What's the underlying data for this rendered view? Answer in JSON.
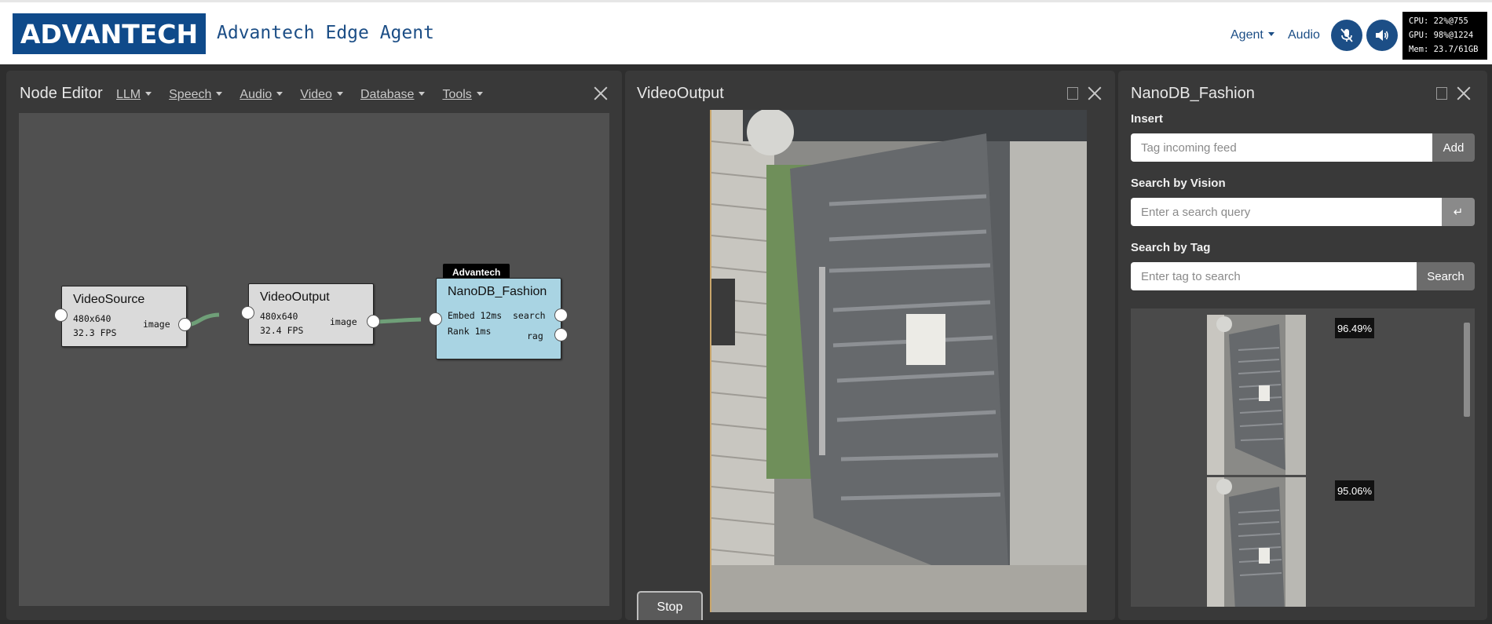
{
  "header": {
    "logo_text": "ADVANTECH",
    "app_title": "Advantech Edge Agent",
    "nav": {
      "agent": "Agent",
      "audio": "Audio"
    },
    "icons": {
      "mic": "mic-mute-icon",
      "speaker": "speaker-icon"
    },
    "stats": {
      "cpu": "CPU: 22%@755",
      "gpu": "GPU: 98%@1224",
      "mem": "Mem: 23.7/61GB"
    }
  },
  "node_editor": {
    "title": "Node Editor",
    "menu": [
      "LLM",
      "Speech",
      "Audio",
      "Video",
      "Database",
      "Tools"
    ],
    "nodes": [
      {
        "title": "VideoSource",
        "line1": "480x640",
        "line2": "32.3 FPS",
        "out": "image"
      },
      {
        "title": "VideoOutput",
        "line1": "480x640",
        "line2": "32.4 FPS",
        "out": "image"
      },
      {
        "title": "NanoDB_Fashion",
        "tag": "Advantech",
        "line1": "Embed 12ms",
        "line2": "Rank 1ms",
        "out1": "search",
        "out2": "rag"
      }
    ]
  },
  "video_output": {
    "title": "VideoOutput",
    "stop_label": "Stop"
  },
  "nanodb": {
    "title": "NanoDB_Fashion",
    "insert": {
      "label": "Insert",
      "placeholder": "Tag incoming feed",
      "button": "Add"
    },
    "vision": {
      "label": "Search by Vision",
      "placeholder": "Enter a search query",
      "button": "↵"
    },
    "tag": {
      "label": "Search by Tag",
      "placeholder": "Enter tag to search",
      "button": "Search"
    },
    "results": [
      {
        "score": "96.49%"
      },
      {
        "score": "95.06%"
      }
    ]
  },
  "colors": {
    "brand": "#0f4a8a",
    "nav_text": "#1c4e86",
    "panel": "#393939",
    "canvas": "#505050",
    "edge": "#6f9f78",
    "node_highlight": "#a9d4e3"
  }
}
